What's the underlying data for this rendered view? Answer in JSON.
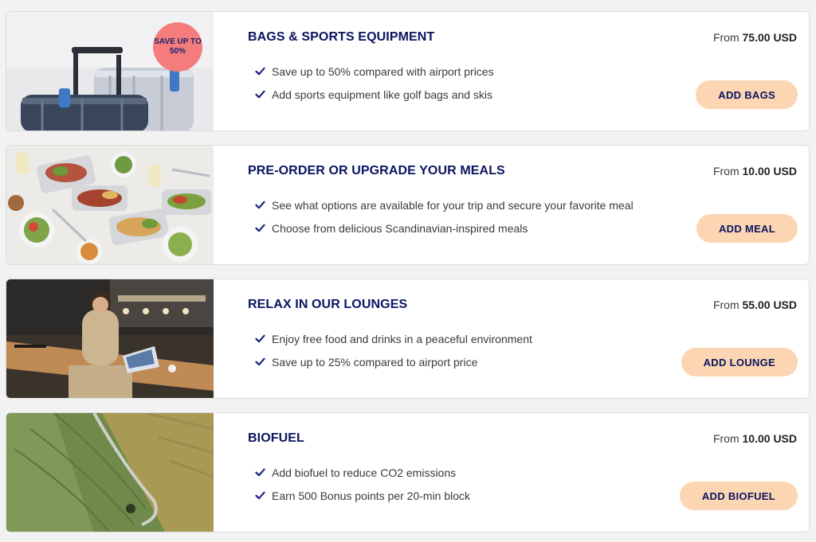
{
  "colors": {
    "title": "#0b1560",
    "button_bg": "#fcd5b2",
    "badge_bg": "#f47c7c",
    "check": "#1a237e"
  },
  "cards": [
    {
      "title": "BAGS & SPORTS EQUIPMENT",
      "price_prefix": "From",
      "price_value": "75.00 USD",
      "features": [
        "Save up to 50% compared with airport prices",
        "Add sports equipment like golf bags and skis"
      ],
      "button": "ADD BAGS",
      "badge": "SAVE UP TO 50%",
      "image_icon": "luggage-image"
    },
    {
      "title": "PRE-ORDER OR UPGRADE YOUR MEALS",
      "price_prefix": "From",
      "price_value": "10.00 USD",
      "features": [
        "See what options are available for your trip and secure your favorite meal",
        "Choose from delicious Scandinavian-inspired meals"
      ],
      "button": "ADD MEAL",
      "image_icon": "meals-image"
    },
    {
      "title": "RELAX IN OUR LOUNGES",
      "price_prefix": "From",
      "price_value": "55.00 USD",
      "features": [
        "Enjoy free food and drinks in a peaceful environment",
        "Save up to 25% compared to airport price"
      ],
      "button": "ADD LOUNGE",
      "image_icon": "lounge-image"
    },
    {
      "title": "BIOFUEL",
      "price_prefix": "From",
      "price_value": "10.00 USD",
      "features": [
        "Add biofuel to reduce CO2 emissions",
        "Earn 500 Bonus points per 20-min block"
      ],
      "button": "ADD BIOFUEL",
      "image_icon": "fields-image"
    }
  ]
}
